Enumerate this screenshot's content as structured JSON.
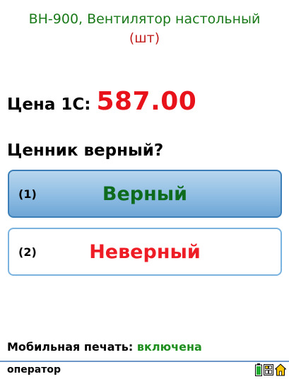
{
  "product": {
    "name": "ВН-900, Вентилятор настольный",
    "unit": "(шт)"
  },
  "price": {
    "label": "Цена 1С:",
    "value": "587.00"
  },
  "question": "Ценник верный?",
  "answers": [
    {
      "key": "(1)",
      "label": "Верный"
    },
    {
      "key": "(2)",
      "label": "Неверный"
    }
  ],
  "mobile_print": {
    "label": "Мобильная печать:",
    "state": "включена"
  },
  "statusbar": {
    "user": "оператор",
    "icons": [
      "battery-icon",
      "keyboard-icon",
      "home-icon"
    ]
  },
  "colors": {
    "product_name": "#1a7a1a",
    "unit": "#c21f1f",
    "price": "#e8121b",
    "answer_correct": "#0e6b1e",
    "answer_wrong": "#ee1c25",
    "print_state": "#1e8f1e",
    "button_border": "#5f9fd3"
  }
}
